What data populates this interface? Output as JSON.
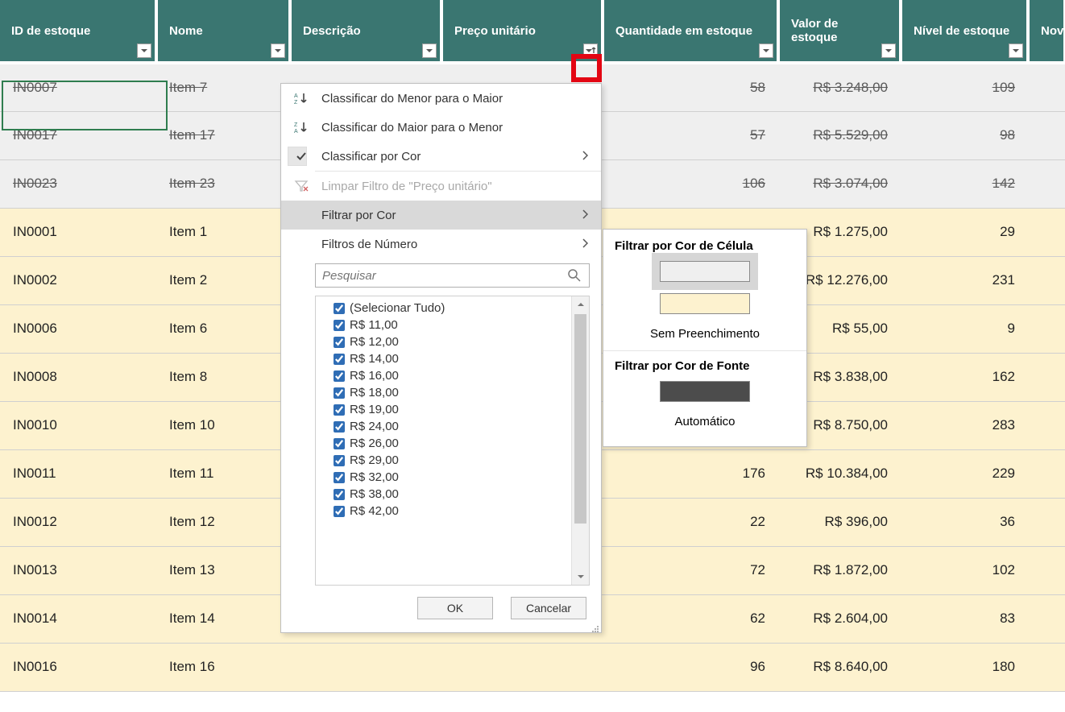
{
  "columns": {
    "id": "ID de estoque",
    "nome": "Nome",
    "desc": "Descrição",
    "preco": "Preço unitário",
    "qtd": "Quantidade em estoque",
    "val": "Valor de estoque",
    "niv": "Nível de estoque",
    "nov": "Nov"
  },
  "rows": [
    {
      "style": "grey",
      "id": "IN0007",
      "nome": "Item 7",
      "qtd": "58",
      "val": "R$ 3.248,00",
      "niv": "109"
    },
    {
      "style": "grey",
      "id": "IN0017",
      "nome": "Item 17",
      "qtd": "57",
      "val": "R$ 5.529,00",
      "niv": "98"
    },
    {
      "style": "grey",
      "id": "IN0023",
      "nome": "Item 23",
      "qtd": "106",
      "val": "R$ 3.074,00",
      "niv": "142"
    },
    {
      "style": "cream",
      "id": "IN0001",
      "nome": "Item 1",
      "qtd": "",
      "val": "R$ 1.275,00",
      "niv": "29"
    },
    {
      "style": "cream",
      "id": "IN0002",
      "nome": "Item 2",
      "qtd": "",
      "val": "R$ 12.276,00",
      "niv": "231"
    },
    {
      "style": "cream",
      "id": "IN0006",
      "nome": "Item 6",
      "qtd": "",
      "val": "R$ 55,00",
      "niv": "9"
    },
    {
      "style": "cream",
      "id": "IN0008",
      "nome": "Item 8",
      "qtd": "",
      "val": "R$ 3.838,00",
      "niv": "162"
    },
    {
      "style": "cream",
      "id": "IN0010",
      "nome": "Item 10",
      "qtd": "",
      "val": "R$ 8.750,00",
      "niv": "283"
    },
    {
      "style": "cream",
      "id": "IN0011",
      "nome": "Item 11",
      "qtd": "176",
      "val": "R$ 10.384,00",
      "niv": "229"
    },
    {
      "style": "cream",
      "id": "IN0012",
      "nome": "Item 12",
      "qtd": "22",
      "val": "R$ 396,00",
      "niv": "36"
    },
    {
      "style": "cream",
      "id": "IN0013",
      "nome": "Item 13",
      "qtd": "72",
      "val": "R$ 1.872,00",
      "niv": "102"
    },
    {
      "style": "cream",
      "id": "IN0014",
      "nome": "Item 14",
      "qtd": "62",
      "val": "R$ 2.604,00",
      "niv": "83"
    },
    {
      "style": "cream",
      "id": "IN0016",
      "nome": "Item 16",
      "qtd": "96",
      "val": "R$ 8.640,00",
      "niv": "180"
    }
  ],
  "menu": {
    "sort_asc": "Classificar do Menor para o Maior",
    "sort_desc": "Classificar do Maior para o Menor",
    "sort_by_color": "Classificar por Cor",
    "clear_filter": "Limpar Filtro de \"Preço unitário\"",
    "filter_by_color": "Filtrar por Cor",
    "number_filters": "Filtros de Número",
    "search_placeholder": "Pesquisar",
    "check_items": [
      "(Selecionar Tudo)",
      "R$ 11,00",
      "R$ 12,00",
      "R$ 14,00",
      "R$ 16,00",
      "R$ 18,00",
      "R$ 19,00",
      "R$ 24,00",
      "R$ 26,00",
      "R$ 29,00",
      "R$ 32,00",
      "R$ 38,00",
      "R$ 42,00"
    ],
    "ok": "OK",
    "cancel": "Cancelar"
  },
  "submenu": {
    "by_cell_color": "Filtrar por Cor de Célula",
    "no_fill": "Sem Preenchimento",
    "by_font_color": "Filtrar por Cor de Fonte",
    "automatic": "Automático",
    "swatch_grey": "#efefef",
    "swatch_cream": "#fdf2cf",
    "swatch_dark": "#4c4c4c"
  },
  "sort_underline": {
    "asc_pos": 0,
    "desc_pos": 0,
    "color_pos": 0
  }
}
